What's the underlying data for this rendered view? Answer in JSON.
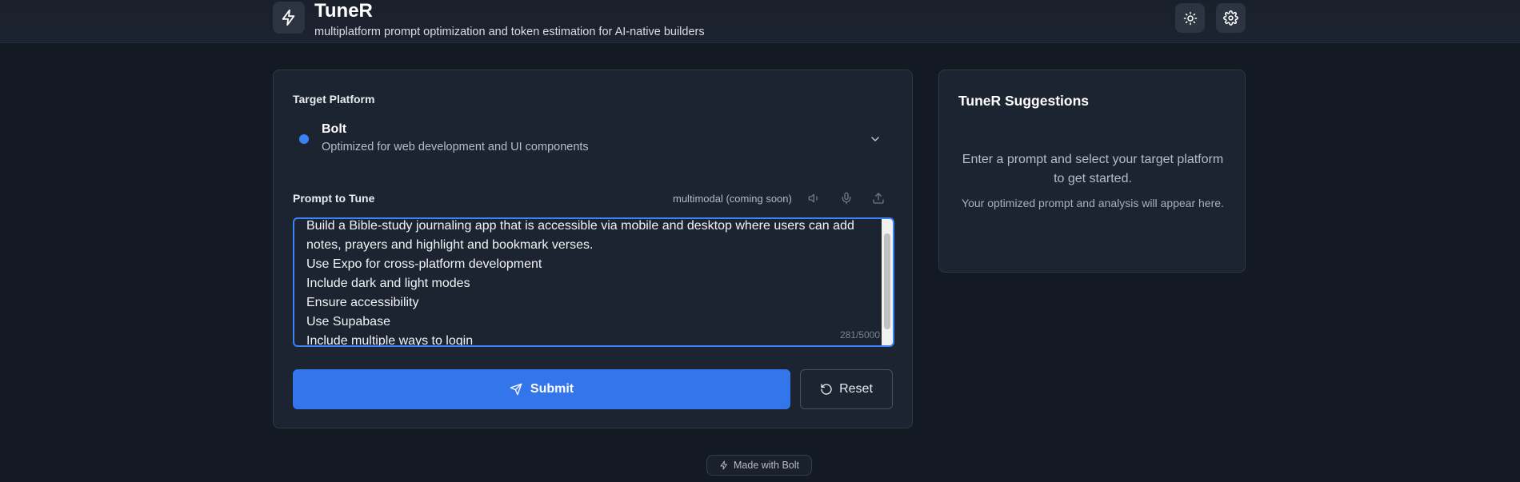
{
  "header": {
    "title": "TuneR",
    "subtitle": "multiplatform prompt optimization and token estimation for AI-native builders",
    "logo_icon": "lightning-bolt-icon",
    "theme_icon": "sun-icon",
    "settings_icon": "gear-icon"
  },
  "form": {
    "platform_label": "Target Platform",
    "platform": {
      "name": "Bolt",
      "description": "Optimized for web development and UI components",
      "dot_color": "#3b82f6"
    },
    "prompt_label": "Prompt to Tune",
    "multimodal_label": "multimodal (coming soon)",
    "prompt_value": "Build a Bible-study journaling app that is accessible via mobile and desktop where users can add\nnotes, prayers and highlight and bookmark verses.\nUse Expo for cross-platform development\nInclude dark and light modes\nEnsure accessibility\nUse Supabase\nInclude multiple ways to login",
    "char_count": "281/5000",
    "submit_label": "Submit",
    "reset_label": "Reset"
  },
  "suggestions": {
    "title": "TuneR Suggestions",
    "message": "Enter a prompt and select your target platform to get started.",
    "sub_message": "Your optimized prompt and analysis will appear here."
  },
  "footer": {
    "made_with": "Made with Bolt"
  },
  "colors": {
    "accent": "#3376eb",
    "background": "#141a24",
    "card": "#1d2431"
  }
}
